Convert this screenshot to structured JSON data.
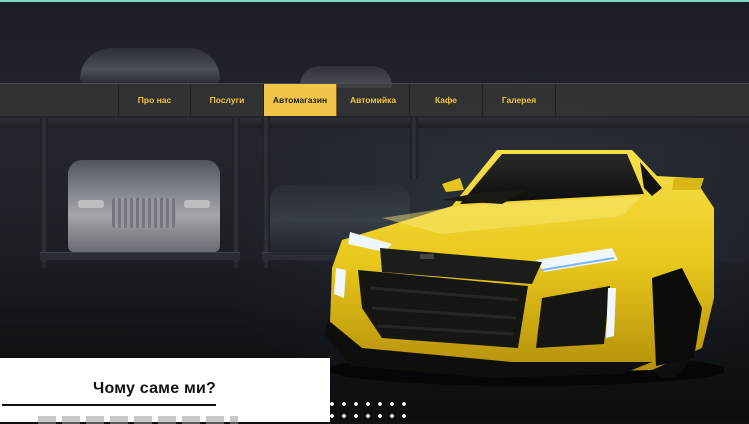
{
  "nav": {
    "items": [
      {
        "label": "Про нас",
        "active": false
      },
      {
        "label": "Послуги",
        "active": false
      },
      {
        "label": "Автомагазин",
        "active": true
      },
      {
        "label": "Автомийка",
        "active": false
      },
      {
        "label": "Кафе",
        "active": false
      },
      {
        "label": "Галерея",
        "active": false
      }
    ]
  },
  "why_section": {
    "title": "Чому саме ми?"
  },
  "colors": {
    "accent_yellow": "#f0c64a",
    "nav_text": "#f2c431",
    "panel_bg": "#ffffff",
    "top_accent": "#7fd6c4"
  },
  "hero": {
    "image_subject": "yellow-sports-car-in-garage"
  }
}
